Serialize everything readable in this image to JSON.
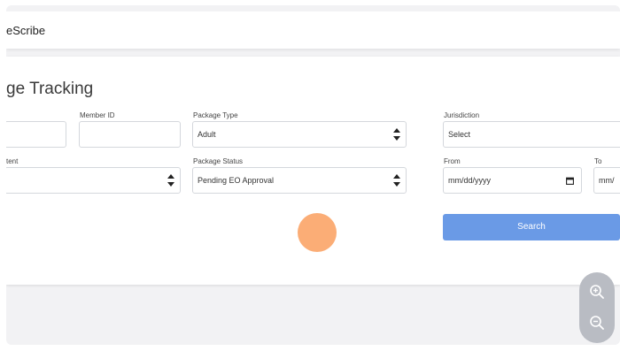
{
  "header": {
    "brand": "eScribe"
  },
  "page": {
    "title": "ge Tracking"
  },
  "form": {
    "member_id_label": "Member ID",
    "package_type_label": "Package Type",
    "package_type_value": "Adult",
    "jurisdiction_label": "Jurisdiction",
    "jurisdiction_value": "Select",
    "content_label": "tent",
    "package_status_label": "Package Status",
    "package_status_value": "Pending EO Approval",
    "from_label": "From",
    "from_placeholder": "mm/dd/yyyy",
    "to_label": "To",
    "to_placeholder": "mm/"
  },
  "actions": {
    "search_label": "Search"
  },
  "zoom": {
    "in_icon": "zoom-in-icon",
    "out_icon": "zoom-out-icon"
  },
  "colors": {
    "primary": "#6a9ae6",
    "cursor": "#f9954f",
    "zoom_bg": "#b9bcc3"
  }
}
